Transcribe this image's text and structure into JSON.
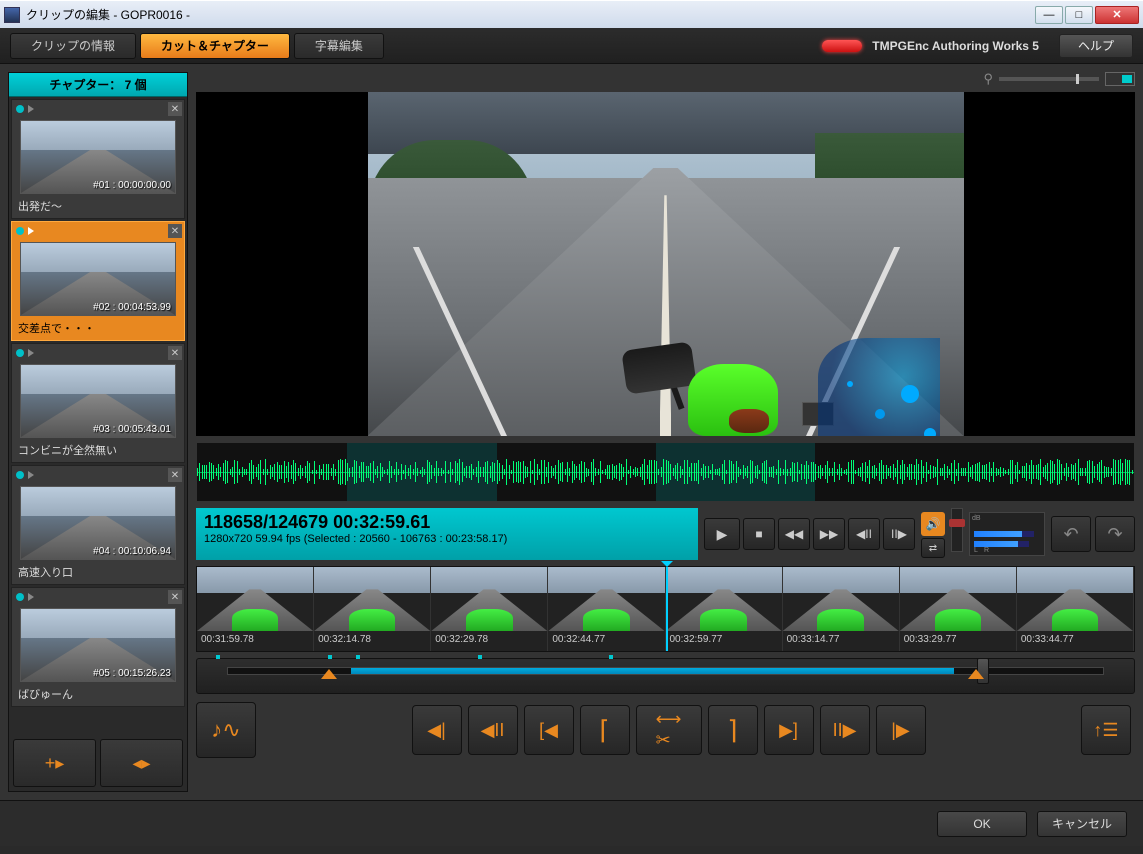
{
  "window": {
    "title": "クリップの編集 - GOPR0016 -",
    "min": "—",
    "max": "□",
    "close": "✕"
  },
  "tabs": {
    "info": "クリップの情報",
    "cut": "カット＆チャプター",
    "subtitle": "字幕編集"
  },
  "brand": "TMPGEnc Authoring Works 5",
  "help": "ヘルプ",
  "chapter_header": "チャプター： 7 個",
  "chapters": [
    {
      "time": "#01 : 00:00:00.00",
      "label": "出発だ～"
    },
    {
      "time": "#02 : 00:04:53.99",
      "label": "交差点で・・・"
    },
    {
      "time": "#03 : 00:05:43.01",
      "label": "コンビニが全然無い"
    },
    {
      "time": "#04 : 00:10:06.94",
      "label": "高速入り口"
    },
    {
      "time": "#05 : 00:15:26.23",
      "label": "ばびゅーん"
    }
  ],
  "timepanel": {
    "main": "118658/124679  00:32:59.61",
    "sub": "1280x720 59.94 fps (Selected : 20560 - 106763 : 00:23:58.17)"
  },
  "filmstrip": [
    "00:31:59.78",
    "00:32:14.78",
    "00:32:29.78",
    "00:32:44.77",
    "00:32:59.77",
    "00:33:14.77",
    "00:33:29.77",
    "00:33:44.77"
  ],
  "footer": {
    "ok": "OK",
    "cancel": "キャンセル"
  },
  "meter": {
    "db": "dB",
    "l": "L",
    "r": "R"
  },
  "zoom": {
    "icon": "⚲"
  }
}
